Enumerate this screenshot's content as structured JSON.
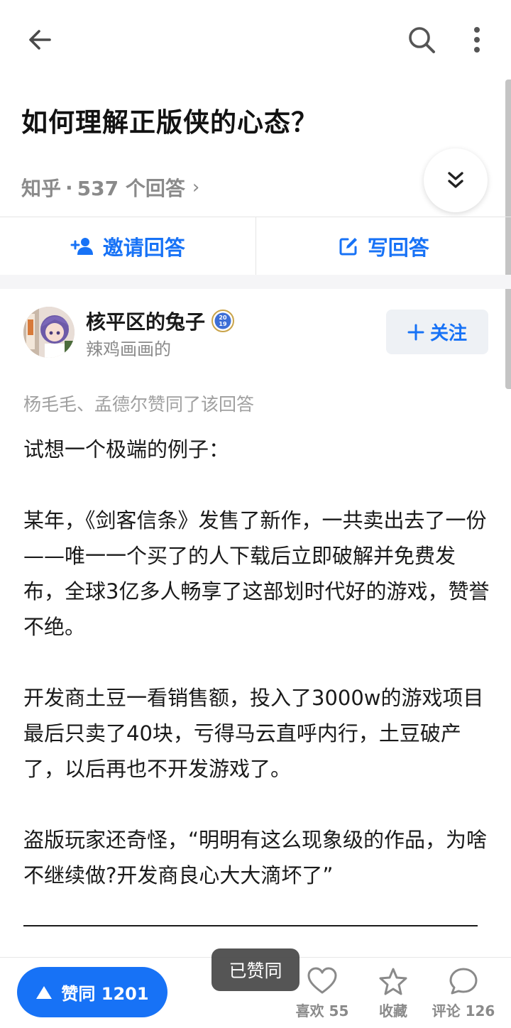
{
  "question": {
    "title": "如何理解正版侠的心态？",
    "source": "知乎",
    "separator": "·",
    "answer_count": "537 个回答"
  },
  "actions": {
    "invite_label": "邀请回答",
    "write_label": "写回答"
  },
  "author": {
    "name": "核平区的兔子",
    "badge": "2019",
    "bio": "辣鸡画画的",
    "follow_label": "关注"
  },
  "upvoters_text": "杨毛毛、孟德尔赞同了该回答",
  "answer": {
    "paragraphs": [
      "试想一个极端的例子：",
      "某年，《剑客信条》发售了新作，一共卖出去了一份——唯一一个买了的人下载后立即破解并免费发布，全球3亿多人畅享了这部划时代好的游戏，赞誉不绝。",
      "开发商土豆一看销售额，投入了3000w的游戏项目最后只卖了40块，亏得马云直呼内行，土豆破产了，以后再也不开发游戏了。",
      "盗版玩家还奇怪，“明明有这么现象级的作品，为啥不继续做?开发商良心大大滴坏了”"
    ]
  },
  "bottom_bar": {
    "vote_label": "赞同 1201",
    "toast": "已赞同",
    "like_label": "喜欢 55",
    "collect_label": "收藏",
    "comment_label": "评论 126"
  },
  "colors": {
    "accent": "#1772f6",
    "muted": "#8a8a8a"
  }
}
